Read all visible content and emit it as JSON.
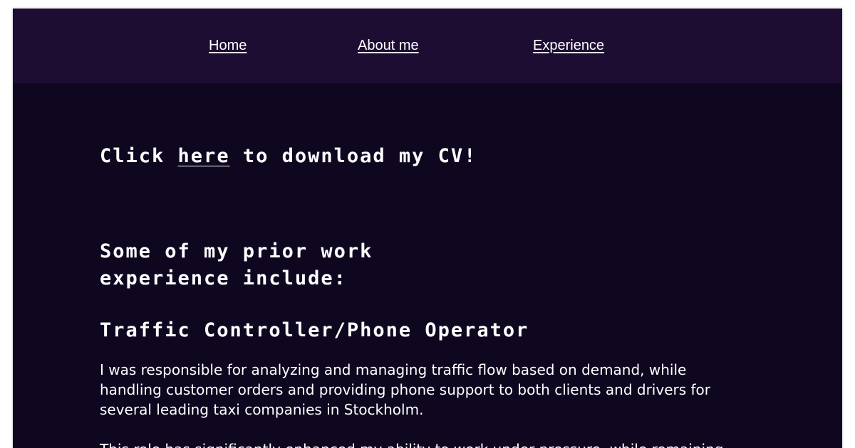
{
  "nav": {
    "items": [
      {
        "label": "Home"
      },
      {
        "label": "About me"
      },
      {
        "label": "Experience"
      }
    ]
  },
  "cv": {
    "prefix": "Click ",
    "link_label": "here",
    "suffix": " to download my CV!"
  },
  "experience": {
    "intro_heading": "Some of my prior work experience include:",
    "jobs": [
      {
        "title": "Traffic Controller/Phone Operator",
        "paragraphs": [
          "I was responsible for analyzing and managing traffic flow based on demand, while handling customer orders and providing phone support to both clients and drivers for several leading taxi companies in Stockholm.",
          "This role has significantly enhanced my ability to work under pressure, while remaining"
        ]
      }
    ]
  },
  "colors": {
    "page_background": "#0f0720",
    "navbar_background": "#1e0d33",
    "text": "#ffffff"
  }
}
